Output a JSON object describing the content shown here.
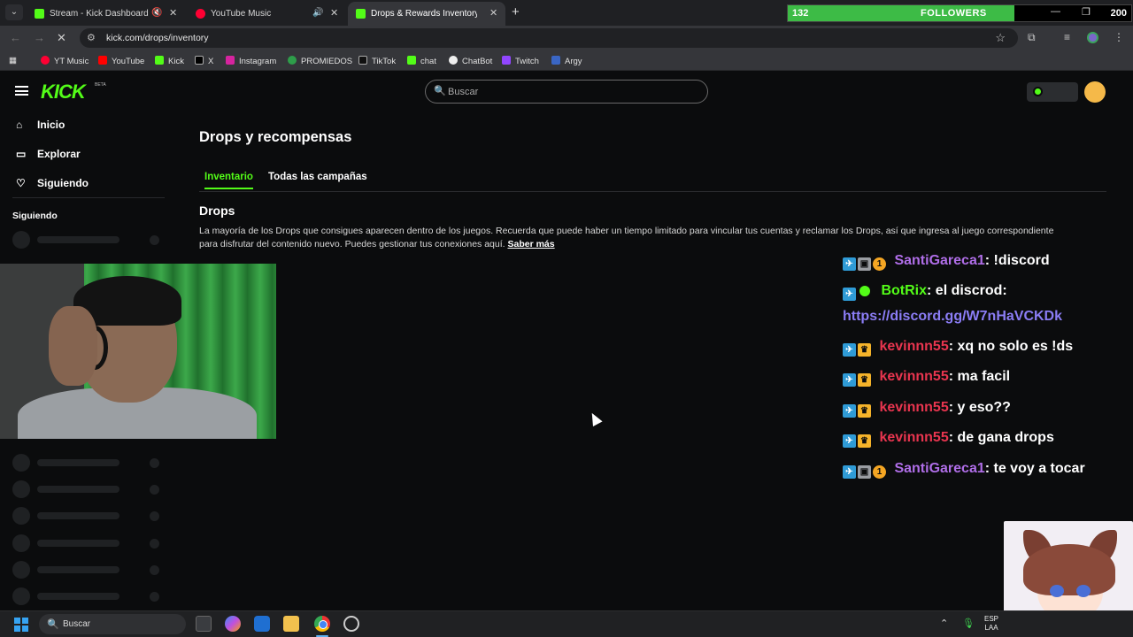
{
  "browser": {
    "tabs": [
      {
        "title": "Stream - Kick Dashboard",
        "favicon": "kick-icon",
        "muted": true
      },
      {
        "title": "YouTube Music",
        "favicon": "youtube-music-icon",
        "muted": false
      },
      {
        "title": "Drops & Rewards Inventory - K",
        "favicon": "kick-icon",
        "active": true
      }
    ],
    "url": "kick.com/drops/inventory",
    "bookmarks": [
      "YT Music",
      "YouTube",
      "Kick",
      "X",
      "Instagram",
      "PROMIEDOS",
      "TikTok",
      "chat",
      "ChatBot",
      "Twitch",
      "Argy"
    ]
  },
  "followers_widget": {
    "current": "132",
    "label": "FOLLOWERS",
    "goal": "200",
    "progress_fraction": 0.66,
    "color": "#3dbb46"
  },
  "kick": {
    "brand_color": "#53fc18",
    "logo_text": "KICK",
    "logo_badge": "BETA",
    "search_placeholder": "Buscar",
    "sidebar": {
      "nav": [
        {
          "label": "Inicio",
          "icon": "home-icon"
        },
        {
          "label": "Explorar",
          "icon": "compass-icon"
        },
        {
          "label": "Siguiendo",
          "icon": "heart-icon"
        }
      ],
      "following_heading": "Siguiendo"
    },
    "page_title": "Drops y recompensas",
    "tabs": [
      "Inventario",
      "Todas las campañas"
    ],
    "section_title": "Drops",
    "description": "La mayoría de los Drops que consigues aparecen dentro de los juegos. Recuerda que puede haber un tiempo limitado para vincular tus cuentas y reclamar los Drops, así que ingresa al juego correspondiente para disfrutar del contenido nuevo. Puedes gestionar tus conexiones aquí.",
    "learn_more": "Saber más"
  },
  "chat": {
    "messages": [
      {
        "user": "SantiGareca1",
        "text": ": !discord",
        "color": "#b06ee8",
        "badges": [
          "pin",
          "gift",
          "sub"
        ]
      },
      {
        "user": "BotRix",
        "text": ": el discrod:",
        "color": "#53fc18",
        "badges": [
          "pin",
          "verified"
        ]
      },
      {
        "link": "https://discord.gg/W7nHaVCKDk"
      },
      {
        "user": "kevinnn55",
        "text": ": xq no solo es !ds",
        "color": "#e8354f",
        "badges": [
          "pin",
          "crown"
        ]
      },
      {
        "user": "kevinnn55",
        "text": ": ma facil",
        "color": "#e8354f",
        "badges": [
          "pin",
          "crown"
        ]
      },
      {
        "user": "kevinnn55",
        "text": ": y eso??",
        "color": "#e8354f",
        "badges": [
          "pin",
          "crown"
        ]
      },
      {
        "user": "kevinnn55",
        "text": ": de gana drops",
        "color": "#e8354f",
        "badges": [
          "pin",
          "crown"
        ]
      },
      {
        "user": "SantiGareca1",
        "text": ": te voy a tocar",
        "color": "#b06ee8",
        "badges": [
          "pin",
          "gift",
          "sub"
        ]
      }
    ]
  },
  "taskbar": {
    "search_placeholder": "Buscar",
    "lang_top": "ESP",
    "lang_bottom": "LAA"
  }
}
